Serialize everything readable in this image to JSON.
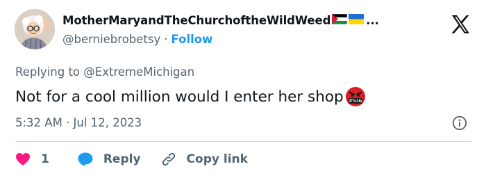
{
  "author": {
    "display_name": "MotherMaryandTheChurchoftheWildWeed",
    "name_ellipsis": "...",
    "handle": "@berniebrobetsy",
    "separator": "·",
    "follow_label": "Follow",
    "flags": [
      "palestine-flag",
      "ukraine-flag"
    ]
  },
  "reply_context": {
    "prefix": "Replying to",
    "mention": "@ExtremeMichigan"
  },
  "tweet": {
    "text": "Not for a cool million would I enter her shop",
    "emoji": "angry-cursing-face"
  },
  "meta": {
    "timestamp": "5:32 AM · Jul 12, 2023"
  },
  "actions": {
    "like_count": "1",
    "reply_label": "Reply",
    "copy_link_label": "Copy link"
  },
  "colors": {
    "accent": "#1d9bf0",
    "like": "#f91880",
    "text_primary": "#0f1419",
    "text_secondary": "#536471",
    "divider": "#cfd9de"
  },
  "icons": [
    "x-logo-icon",
    "info-icon",
    "heart-icon",
    "reply-bubble-icon",
    "link-icon"
  ]
}
